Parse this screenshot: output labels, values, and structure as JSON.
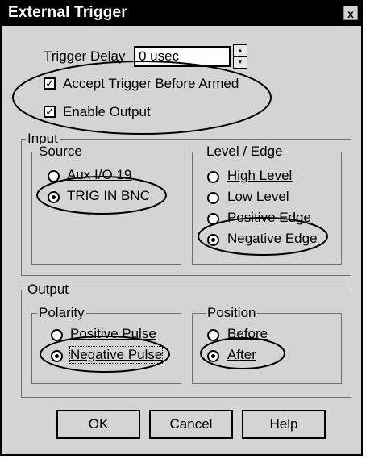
{
  "window": {
    "title": "External Trigger",
    "close_glyph": "x"
  },
  "trigger_delay": {
    "label": "Trigger Delay",
    "value": "0 usec"
  },
  "checkboxes": {
    "accept_before_armed": {
      "label": "Accept Trigger Before Armed",
      "checked": true
    },
    "enable_output": {
      "label": "Enable Output",
      "checked": true
    }
  },
  "input_group": {
    "label": "Input",
    "source": {
      "label": "Source",
      "options": [
        {
          "label": "Aux I/O 19",
          "selected": false
        },
        {
          "label": "TRIG IN BNC",
          "selected": true
        }
      ]
    },
    "level_edge": {
      "label": "Level / Edge",
      "options": [
        {
          "label": "High Level",
          "selected": false
        },
        {
          "label": "Low Level",
          "selected": false
        },
        {
          "label": "Positive Edge",
          "selected": false
        },
        {
          "label": "Negative Edge",
          "selected": true
        }
      ]
    }
  },
  "output_group": {
    "label": "Output",
    "polarity": {
      "label": "Polarity",
      "options": [
        {
          "label": "Positive Pulse",
          "selected": false
        },
        {
          "label": "Negative Pulse",
          "selected": true
        }
      ]
    },
    "position": {
      "label": "Position",
      "options": [
        {
          "label": "Before",
          "selected": false
        },
        {
          "label": "After",
          "selected": true
        }
      ]
    }
  },
  "buttons": {
    "ok": "OK",
    "cancel": "Cancel",
    "help": "Help"
  }
}
